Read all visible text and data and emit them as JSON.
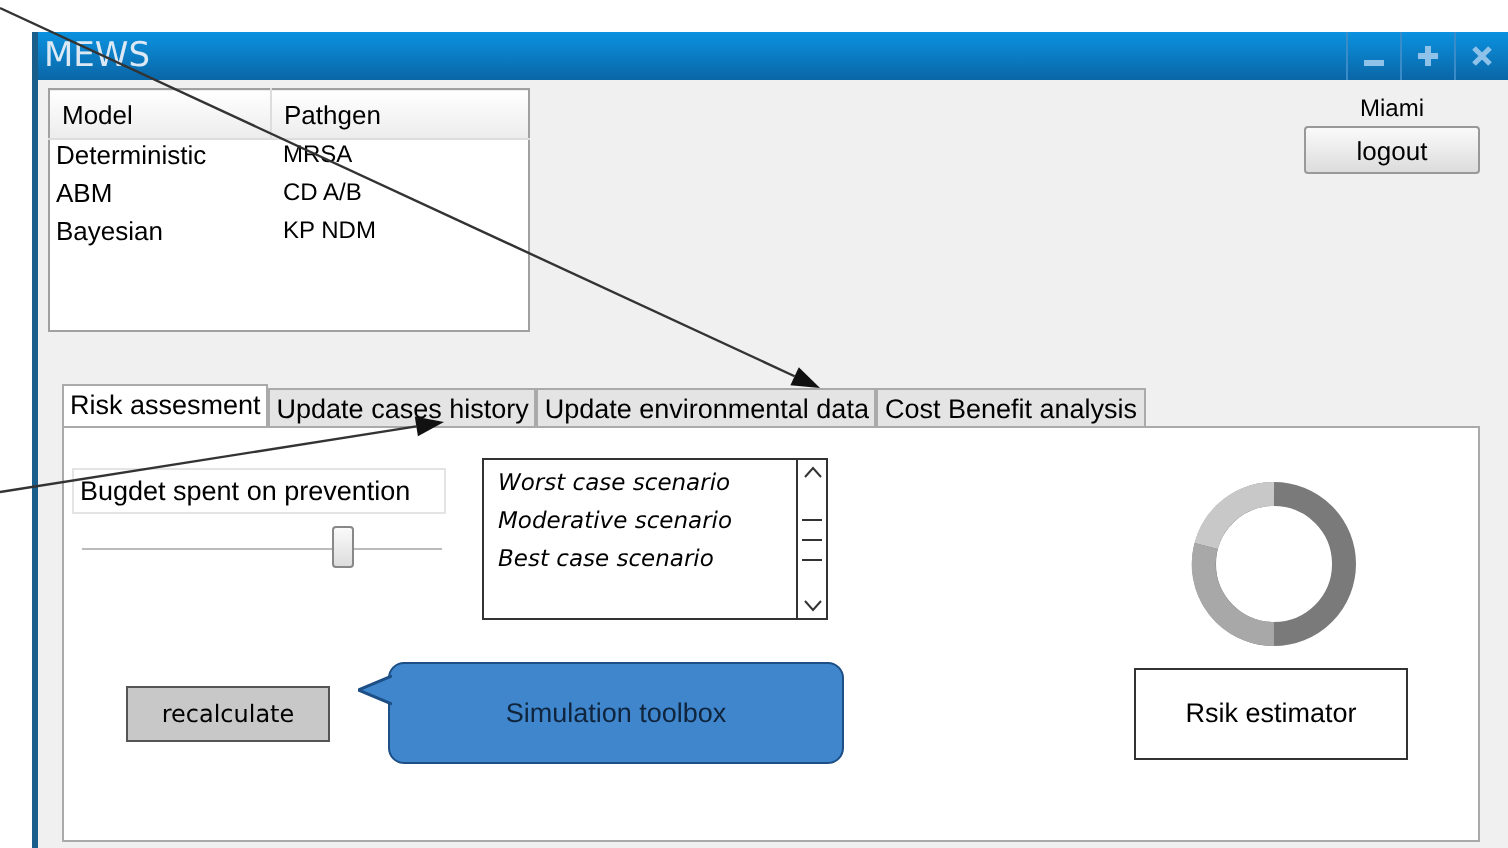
{
  "window": {
    "title": "MEWS"
  },
  "table": {
    "columns": [
      "Model",
      "Pathgen"
    ],
    "rows": [
      [
        "Deterministic",
        "MRSA"
      ],
      [
        "ABM",
        "CD  A/B"
      ],
      [
        "Bayesian",
        "KP  NDM"
      ]
    ]
  },
  "user": {
    "name": "Miami",
    "logout": "logout"
  },
  "tabs": [
    {
      "label": "Risk assesment",
      "selected": true
    },
    {
      "label": "Update cases history",
      "selected": false
    },
    {
      "label": "Update environmental data",
      "selected": false
    },
    {
      "label": "Cost Benefit analysis",
      "selected": false
    }
  ],
  "budget": {
    "label": "Bugdet spent on prevention",
    "level": 0.73
  },
  "scenarios": [
    "Worst case scenario",
    "Moderative scenario",
    "Best case scenario"
  ],
  "recalculate": "recalculate",
  "callout": "Simulation toolbox",
  "estimator": "Rsik estimator"
}
